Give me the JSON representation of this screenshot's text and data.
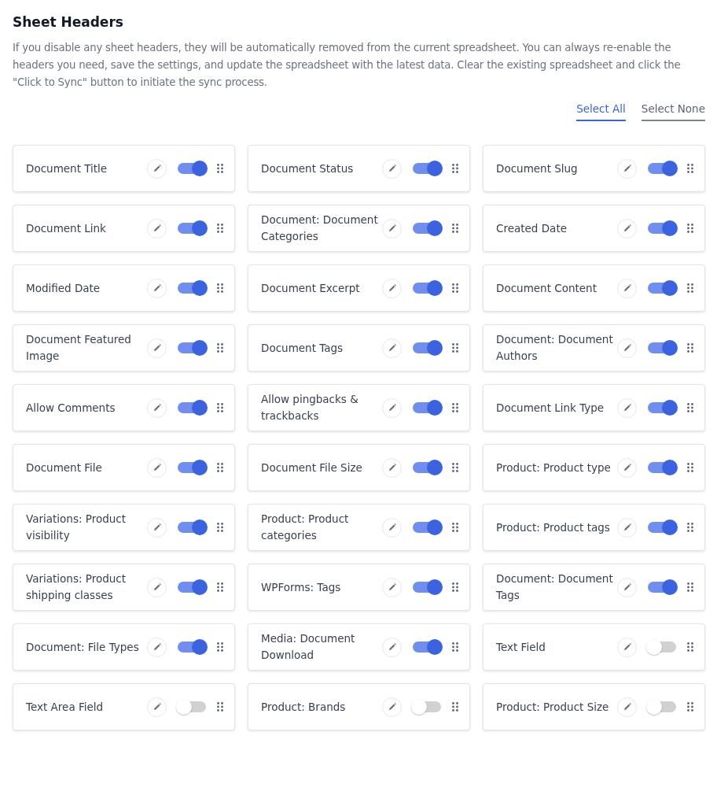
{
  "title": "Sheet Headers",
  "description": "If you disable any sheet headers, they will be automatically removed from the current spreadsheet. You can always re-enable the headers you need, save the settings, and update the spreadsheet with the latest data. Clear the existing spreadsheet and click the \"Click to Sync\" button to initiate the sync process.",
  "selection_links": [
    {
      "label": "Select All",
      "selected": true
    },
    {
      "label": "Select None",
      "selected": false
    }
  ],
  "headers": [
    {
      "label": "Document Title",
      "on": true
    },
    {
      "label": "Document Status",
      "on": true
    },
    {
      "label": "Document Slug",
      "on": true
    },
    {
      "label": "Document Link",
      "on": true
    },
    {
      "label": "Document: Document Categories",
      "on": true
    },
    {
      "label": "Created Date",
      "on": true
    },
    {
      "label": "Modified Date",
      "on": true
    },
    {
      "label": "Document Excerpt",
      "on": true
    },
    {
      "label": "Document Content",
      "on": true
    },
    {
      "label": "Document Featured Image",
      "on": true
    },
    {
      "label": "Document Tags",
      "on": true
    },
    {
      "label": "Document: Document Authors",
      "on": true
    },
    {
      "label": "Allow Comments",
      "on": true
    },
    {
      "label": "Allow pingbacks & trackbacks",
      "on": true
    },
    {
      "label": "Document Link Type",
      "on": true
    },
    {
      "label": "Document File",
      "on": true
    },
    {
      "label": "Document File Size",
      "on": true
    },
    {
      "label": "Product: Product type",
      "on": true
    },
    {
      "label": "Variations: Product visibility",
      "on": true
    },
    {
      "label": "Product: Product categories",
      "on": true
    },
    {
      "label": "Product: Product tags",
      "on": true
    },
    {
      "label": "Variations: Product shipping classes",
      "on": true
    },
    {
      "label": "WPForms: Tags",
      "on": true
    },
    {
      "label": "Document: Document Tags",
      "on": true
    },
    {
      "label": "Document: File Types",
      "on": true
    },
    {
      "label": "Media: Document Download",
      "on": true
    },
    {
      "label": "Text Field",
      "on": false
    },
    {
      "label": "Text Area Field",
      "on": false
    },
    {
      "label": "Product: Brands",
      "on": false
    },
    {
      "label": "Product: Product Size",
      "on": false
    }
  ]
}
